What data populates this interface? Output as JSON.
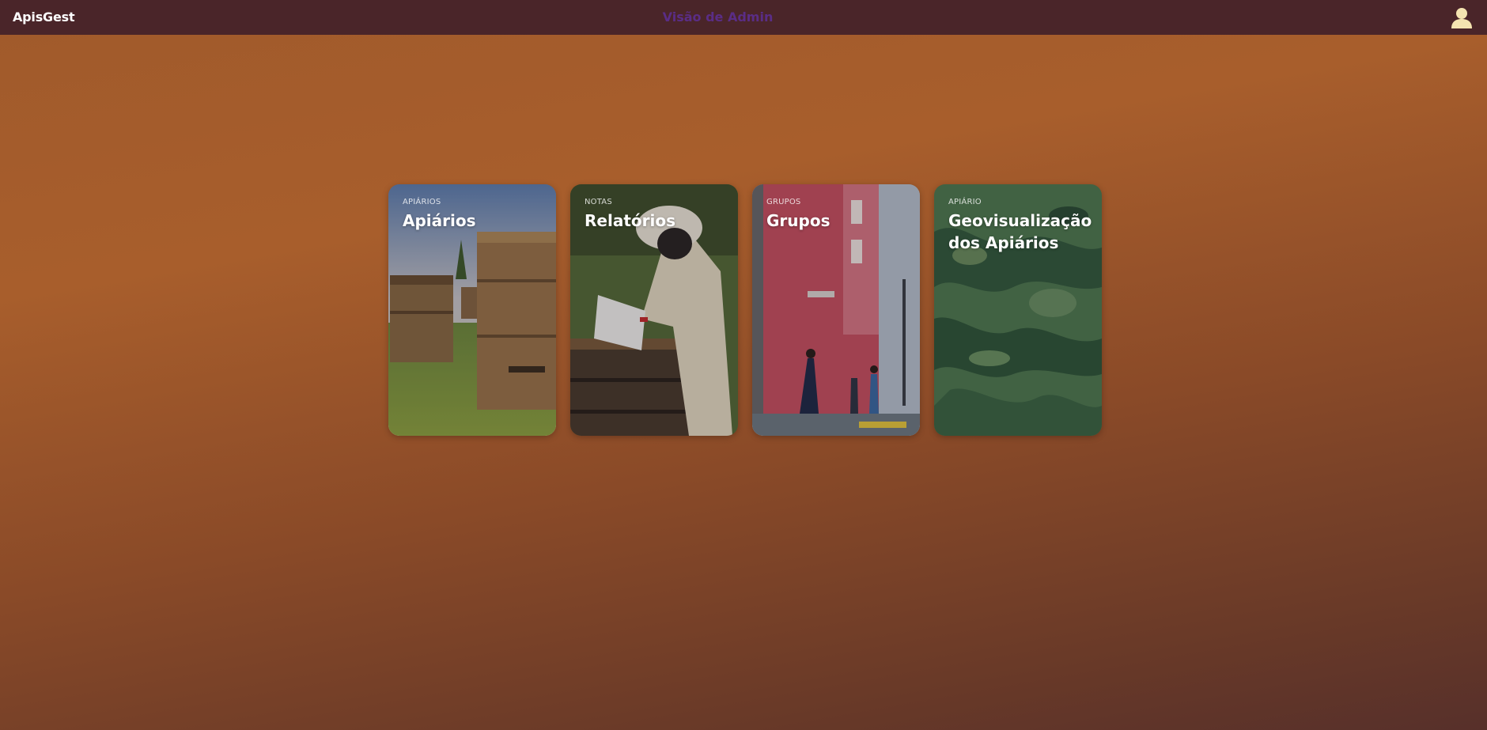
{
  "header": {
    "brand": "ApisGest",
    "title": "Visão de Admin",
    "user_icon": "user-icon"
  },
  "cards": [
    {
      "kicker": "APIÁRIOS",
      "title": "Apiários"
    },
    {
      "kicker": "NOTAS",
      "title": "Relatórios"
    },
    {
      "kicker": "GRUPOS",
      "title": "Grupos"
    },
    {
      "kicker": "APIÁRIO",
      "title": "Geovisualização dos Apiários"
    }
  ],
  "colors": {
    "header_bg": "#4a2529",
    "title": "#5a2d86",
    "user_icon": "#f4e3b0",
    "bg_top": "#a85e2c",
    "bg_bottom": "#57302a"
  }
}
